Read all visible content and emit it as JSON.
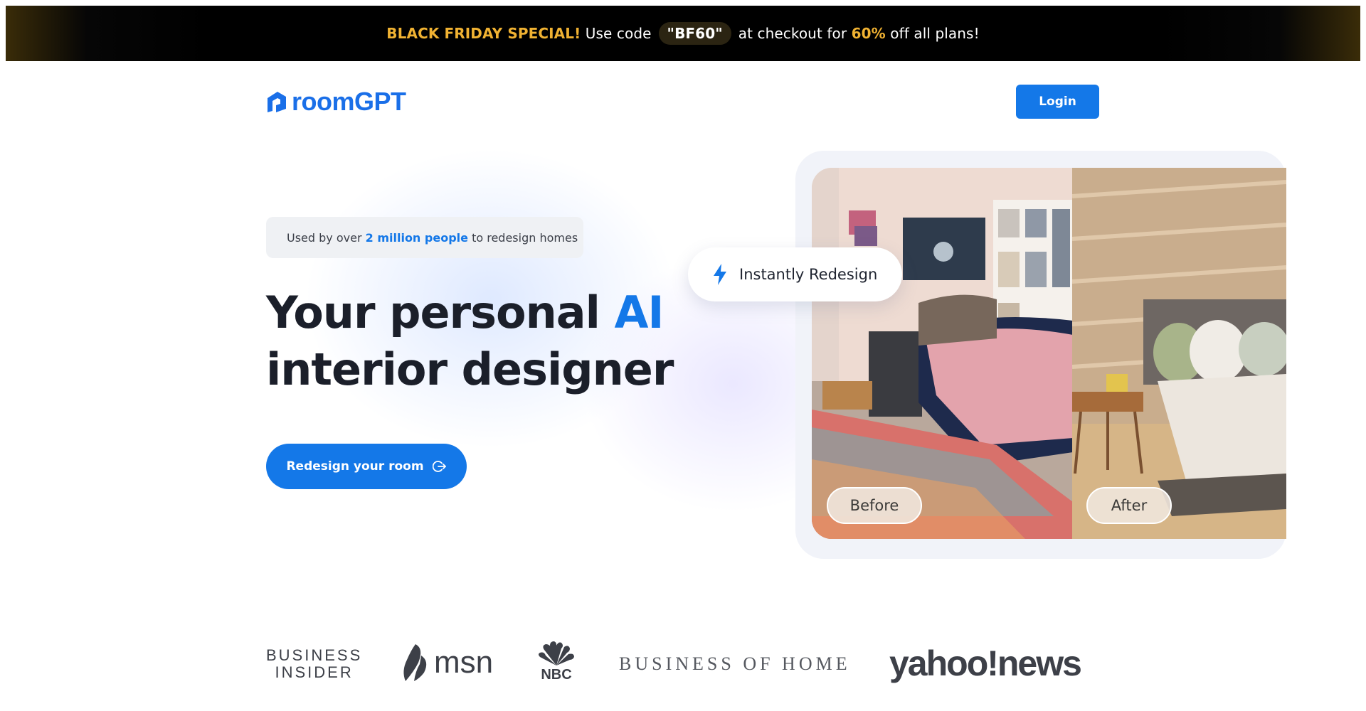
{
  "promo": {
    "highlight": "BLACK FRIDAY SPECIAL!",
    "text_before_code": "Use code",
    "code": "\"BF60\"",
    "text_after_code": "at checkout for",
    "discount": "60%",
    "text_end": "off all plans!",
    "accent_color": "#f0b232"
  },
  "header": {
    "logo_text": "roomGPT",
    "login_label": "Login"
  },
  "hero": {
    "usage_prefix": "Used by over",
    "usage_highlight": "2 million people",
    "usage_suffix": "to redesign homes",
    "title_line1_part1": "Your personal",
    "title_line1_part2": "AI",
    "title_line2": "interior designer",
    "cta_label": "Redesign your room"
  },
  "showcase": {
    "badge_label": "Instantly Redesign",
    "before_label": "Before",
    "after_label": "After"
  },
  "press": {
    "business_insider_line1": "BUSINESS",
    "business_insider_line2": "INSIDER",
    "msn": "msn",
    "nbc": "NBC",
    "business_of_home": "BUSINESS OF HOME",
    "yahoo_news": "yahoo!news"
  },
  "colors": {
    "brand_blue": "#1478e8",
    "banner_background": "#000000"
  }
}
